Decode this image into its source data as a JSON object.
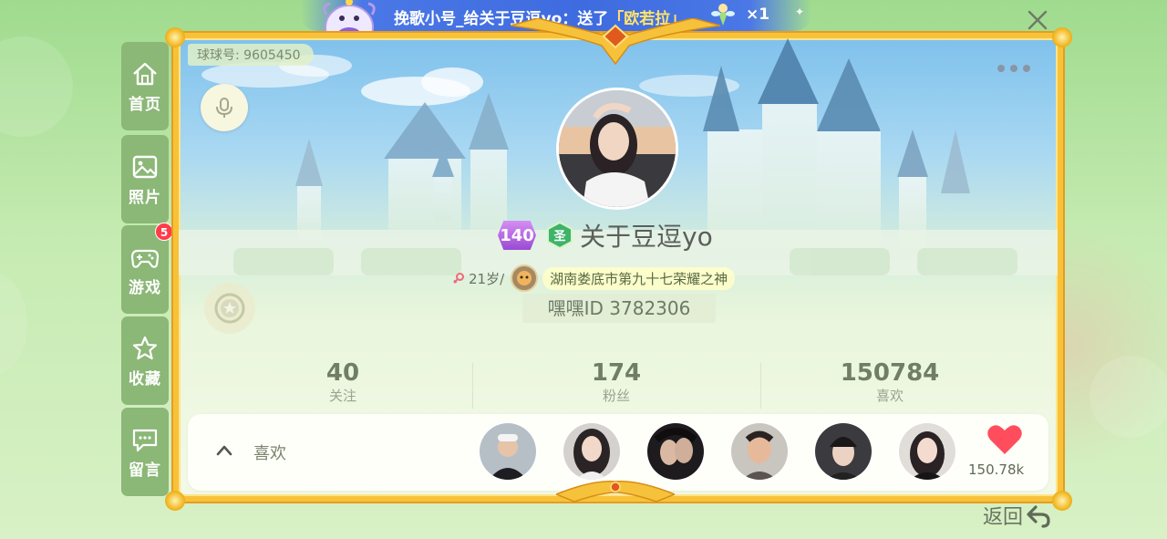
{
  "banner": {
    "sender": "挽歌小号",
    "text_give": "_给关于豆逗yo：送了",
    "gift": "「欧若拉」",
    "multiplier": "×1"
  },
  "nav": {
    "items": [
      {
        "label": "首页",
        "icon": "home-icon"
      },
      {
        "label": "照片",
        "icon": "photo-icon"
      },
      {
        "label": "游戏",
        "icon": "gamepad-icon"
      },
      {
        "label": "收藏",
        "icon": "star-icon"
      },
      {
        "label": "留言",
        "icon": "message-icon"
      }
    ],
    "badge": "5"
  },
  "profile": {
    "qiuqiu_id": "球球号: 9605450",
    "level": "140",
    "name": "关于豆逗yo",
    "age": "21岁/",
    "title": "湖南娄底市第九十七荣耀之神",
    "heihei_id": "嘿嘿ID 3782306"
  },
  "stats": [
    {
      "value": "40",
      "label": "关注"
    },
    {
      "value": "174",
      "label": "粉丝"
    },
    {
      "value": "150784",
      "label": "喜欢"
    }
  ],
  "likes": {
    "label": "喜欢",
    "count": "150.78k"
  },
  "back_label": "返回",
  "colors": {
    "nav_bg": "#8bb777",
    "frame_gold": "#f7c23a",
    "banner_blue": "#3e6bdf",
    "heart": "#ff4d5e"
  }
}
